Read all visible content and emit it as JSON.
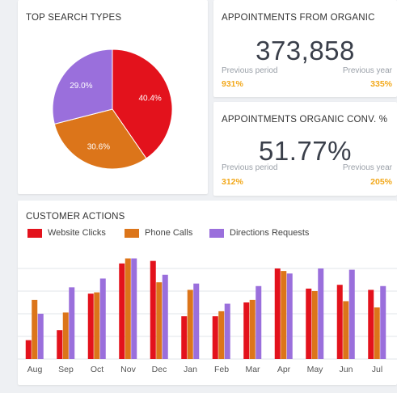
{
  "pie_card": {
    "title": "TOP SEARCH TYPES"
  },
  "appointments_card": {
    "title": "APPOINTMENTS FROM ORGANIC",
    "value": "373,858",
    "prev_period_label": "Previous period",
    "prev_period_value": "931%",
    "prev_year_label": "Previous year",
    "prev_year_value": "335%"
  },
  "conversion_card": {
    "title": "APPOINTMENTS ORGANIC CONV. %",
    "value": "51.77%",
    "prev_period_label": "Previous period",
    "prev_period_value": "312%",
    "prev_year_label": "Previous year",
    "prev_year_value": "205%"
  },
  "actions_card": {
    "title": "CUSTOMER ACTIONS"
  },
  "colors": {
    "red": "#e3121c",
    "orange": "#dc751a",
    "purple": "#9a6fdc",
    "accent_yellow": "#f2a81a"
  },
  "chart_data": [
    {
      "type": "pie",
      "title": "TOP SEARCH TYPES",
      "slices": [
        {
          "label": "40.4%",
          "value": 40.4,
          "color": "#e3121c"
        },
        {
          "label": "30.6%",
          "value": 30.6,
          "color": "#dc751a"
        },
        {
          "label": "29.0%",
          "value": 29.0,
          "color": "#9a6fdc"
        }
      ]
    },
    {
      "type": "bar",
      "title": "CUSTOMER ACTIONS",
      "categories": [
        "Aug",
        "Sep",
        "Oct",
        "Nov",
        "Dec",
        "Jan",
        "Feb",
        "Mar",
        "Apr",
        "May",
        "Jun",
        "Jul"
      ],
      "series": [
        {
          "name": "Website Clicks",
          "color": "#e3121c",
          "values": [
            15,
            23,
            52,
            76,
            78,
            34,
            34,
            45,
            72,
            56,
            59,
            55
          ]
        },
        {
          "name": "Phone Calls",
          "color": "#dc751a",
          "values": [
            47,
            37,
            53,
            80,
            61,
            55,
            38,
            47,
            70,
            54,
            46,
            41
          ]
        },
        {
          "name": "Directions Requests",
          "color": "#9a6fdc",
          "values": [
            36,
            57,
            64,
            80,
            67,
            60,
            44,
            58,
            68,
            72,
            71,
            58
          ]
        }
      ],
      "ylim": [
        0,
        90
      ],
      "grid": true,
      "legend": "top-left"
    }
  ]
}
